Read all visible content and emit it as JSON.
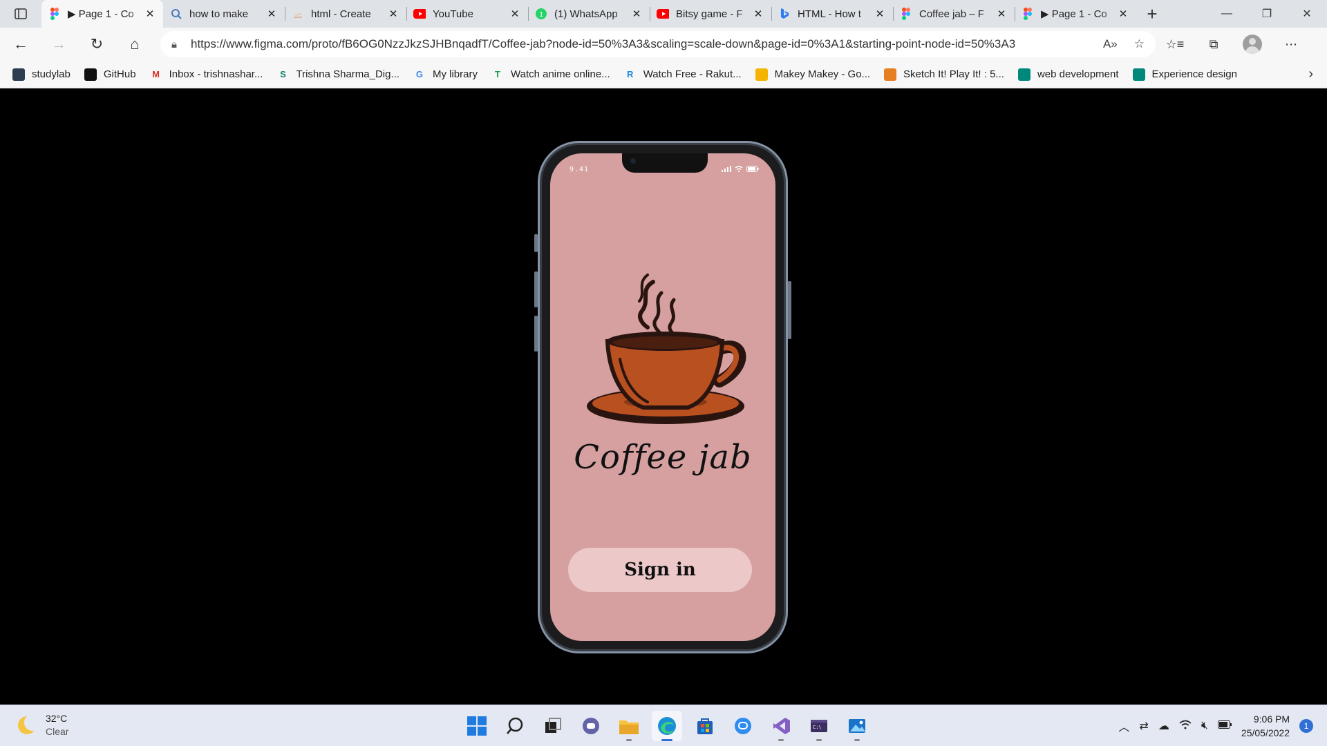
{
  "browser": {
    "tabs": [
      {
        "title": "▶ Page 1 - Co",
        "icon": "figma-icon",
        "active": true
      },
      {
        "title": "how to make",
        "icon": "search-icon"
      },
      {
        "title": "html - Create",
        "icon": "stackoverflow-icon"
      },
      {
        "title": "YouTube",
        "icon": "youtube-icon"
      },
      {
        "title": "(1) WhatsApp",
        "icon": "whatsapp-icon"
      },
      {
        "title": "Bitsy game - F",
        "icon": "youtube-icon"
      },
      {
        "title": "HTML - How t",
        "icon": "bing-icon"
      },
      {
        "title": "Coffee jab – F",
        "icon": "figma-icon"
      },
      {
        "title": "▶ Page 1 - Co",
        "icon": "figma-icon"
      }
    ],
    "url": "https://www.figma.com/proto/fB6OG0NzzJkzSJHBnqadfT/Coffee-jab?node-id=50%3A3&scaling=scale-down&page-id=0%3A1&starting-point-node-id=50%3A3",
    "bookmarks": [
      {
        "label": "studylab",
        "icon": "studylab-icon",
        "color": "#2c3e50",
        "glyph": ""
      },
      {
        "label": "GitHub",
        "icon": "github-icon",
        "color": "#111111",
        "glyph": ""
      },
      {
        "label": "Inbox - trishnashar...",
        "icon": "gmail-icon",
        "color": "#d93025",
        "glyph": "M"
      },
      {
        "label": "Trishna Sharma_Dig...",
        "icon": "sway-icon",
        "color": "#13836e",
        "glyph": "S"
      },
      {
        "label": "My library",
        "icon": "google-icon",
        "color": "#4285f4",
        "glyph": "G"
      },
      {
        "label": "Watch anime online...",
        "icon": "shield-icon",
        "color": "#1f9d55",
        "glyph": "T"
      },
      {
        "label": "Watch Free - Rakut...",
        "icon": "rakuten-icon",
        "color": "#1e88e5",
        "glyph": "R"
      },
      {
        "label": "Makey Makey - Go...",
        "icon": "slides-icon",
        "color": "#f4b400",
        "glyph": ""
      },
      {
        "label": "Sketch It! Play It! : 5...",
        "icon": "sketch-icon",
        "color": "#e67e22",
        "glyph": ""
      },
      {
        "label": "web development",
        "icon": "meet-icon",
        "color": "#00897b",
        "glyph": ""
      },
      {
        "label": "Experience design",
        "icon": "meet-icon",
        "color": "#00897b",
        "glyph": ""
      }
    ]
  },
  "prototype": {
    "status_time": "9.41",
    "app_title": "Coffee jab",
    "signin_label": "Sign in",
    "colors": {
      "screen": "#d5a09f",
      "button": "#ecc8c8",
      "cup": "#b9501f",
      "outline": "#2a1410"
    }
  },
  "taskbar": {
    "weather_temp": "32°C",
    "weather_desc": "Clear",
    "time": "9:06 PM",
    "date": "25/05/2022",
    "notifications": "1"
  }
}
